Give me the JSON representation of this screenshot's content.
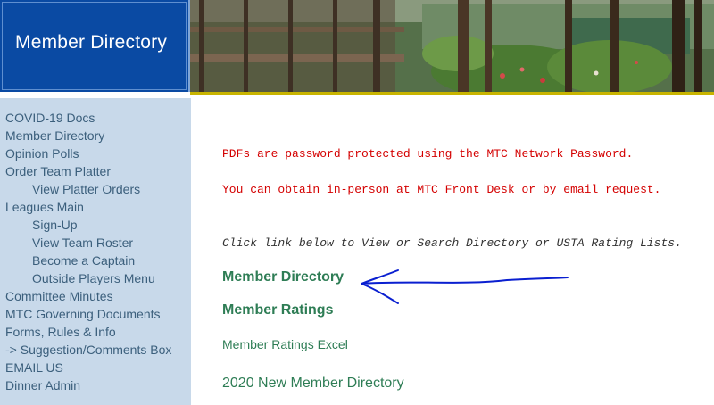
{
  "header": {
    "title": "Member Directory"
  },
  "sidebar": {
    "items": [
      {
        "label": "COVID-19 Docs"
      },
      {
        "label": "Member Directory"
      },
      {
        "label": "Opinion Polls"
      },
      {
        "label": "Order Team Platter"
      },
      {
        "label": "View Platter Orders"
      },
      {
        "label": "Leagues Main"
      },
      {
        "label": "Sign-Up"
      },
      {
        "label": "View Team Roster"
      },
      {
        "label": "Become a Captain"
      },
      {
        "label": "Outside Players Menu"
      },
      {
        "label": "Committee Minutes"
      },
      {
        "label": "MTC Governing Documents"
      },
      {
        "label": "Forms, Rules & Info"
      },
      {
        "label": "-> Suggestion/Comments Box"
      },
      {
        "label": "EMAIL US"
      },
      {
        "label": "Dinner Admin"
      }
    ]
  },
  "main": {
    "notice_1": "PDFs are password protected using the MTC Network Password.",
    "notice_2": "You can obtain in-person at MTC Front Desk or by email request.",
    "instructions": "Click link below to View or Search Directory or USTA Rating Lists.",
    "links": {
      "member_directory": "Member Directory",
      "member_ratings": "Member Ratings",
      "member_ratings_excel": "Member Ratings Excel",
      "new_member_directory": "2020 New Member Directory"
    }
  },
  "colors": {
    "header_blue": "#0d47a1",
    "sidebar_bg": "#c8d9ea",
    "sidebar_link": "#3b5f7c",
    "notice_red": "#d40000",
    "link_green": "#2e7d55",
    "annotation_blue": "#0a1fd0"
  }
}
